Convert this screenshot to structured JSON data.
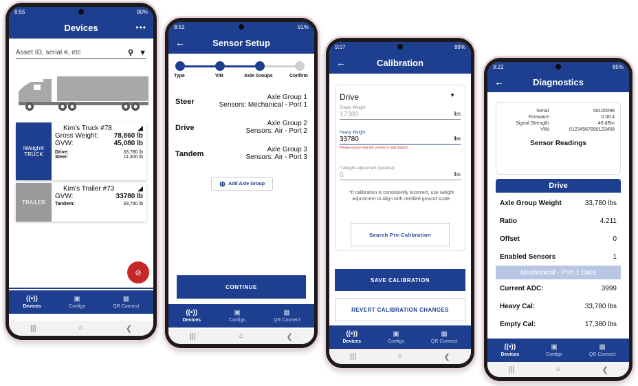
{
  "phone1": {
    "status_time": "8:55",
    "status_right": "90%",
    "title": "Devices",
    "more": "•••",
    "search_placeholder": "Asset ID, serial #, etc",
    "truck_card": {
      "tag": "iWeigh® TRUCK",
      "name": "Kim's Truck #78",
      "gross_label": "Gross Weight:",
      "gross_value": "78,860 lb",
      "gvw_label": "GVW:",
      "gvw_value": "45,080 lb",
      "drive_label": "Drive:",
      "drive_value": "33,780 lb",
      "steer_label": "Steer:",
      "steer_value": "11,300 lb"
    },
    "trailer_card": {
      "tag": "TRAILER",
      "name": "Kim's Trailer #73",
      "gvw_label": "GVW:",
      "gvw_value": "33780 lb",
      "tandem_label": "Tandem:",
      "tandem_value": "33,780 lb"
    }
  },
  "phone2": {
    "status_time": "8:52",
    "status_right": "91%",
    "title": "Sensor Setup",
    "steps": [
      "Type",
      "VIN",
      "Axle Groups",
      "Confirm"
    ],
    "rows": [
      {
        "label": "Steer",
        "group": "Axle Group 1",
        "sensors": "Sensors: Mechanical - Port 1"
      },
      {
        "label": "Drive",
        "group": "Axle Group 2",
        "sensors": "Sensors: Air - Port 2"
      },
      {
        "label": "Tandem",
        "group": "Axle Group 3",
        "sensors": "Sensors: Air - Port 3"
      }
    ],
    "add_group": "Add Axle Group",
    "continue": "CONTINUE"
  },
  "phone3": {
    "status_time": "9:07",
    "status_right": "88%",
    "title": "Calibration",
    "select_value": "Drive",
    "empty_label": "Empty Weight",
    "empty_value": "17380",
    "unit": "lbs",
    "heavy_label": "Heavy Weight",
    "heavy_value": "33780",
    "heavy_error": "Please ensure that the vehicle is fully loaded",
    "adj_label": "* Weight adjustment (optional)",
    "adj_value": "0",
    "note": "*If calibration is consistently incorrect, use weight adjustment to align with certified ground scale.",
    "search_pre": "Search Pre-Calibration",
    "save": "SAVE CALIBRATION",
    "revert": "REVERT CALIBRATION CHANGES"
  },
  "phone4": {
    "status_time": "9:22",
    "status_right": "85%",
    "title": "Diagnostics",
    "info": [
      {
        "k": "Serial:",
        "v": "00100098"
      },
      {
        "k": "Firmware:",
        "v": "0.06.4"
      },
      {
        "k": "Signal Strength:",
        "v": "-49 dBm"
      },
      {
        "k": "VIN:",
        "v": "01234567890123456"
      }
    ],
    "sensor_readings": "Sensor Readings",
    "section": "Drive",
    "rows1": [
      {
        "k": "Axle Group Weight",
        "v": "33,780 lbs"
      },
      {
        "k": "Ratio",
        "v": "4.211"
      },
      {
        "k": "Offset",
        "v": "0"
      },
      {
        "k": "Enabled Sensors",
        "v": "1"
      }
    ],
    "subsection": "Mechanical - Port 1 Data",
    "rows2": [
      {
        "k": "Current ADC:",
        "v": "3999"
      },
      {
        "k": "Heavy Cal:",
        "v": "33,780 lbs"
      },
      {
        "k": "Empty Cal:",
        "v": "17,380 lbs"
      }
    ]
  },
  "nav": {
    "devices": "Devices",
    "configs": "Configs",
    "qr": "QR Connect"
  },
  "colors": {
    "primary": "#1e3f8f",
    "trailer_tag": "#9a9a9a",
    "error": "#d32f2f",
    "fab": "#c62828"
  }
}
